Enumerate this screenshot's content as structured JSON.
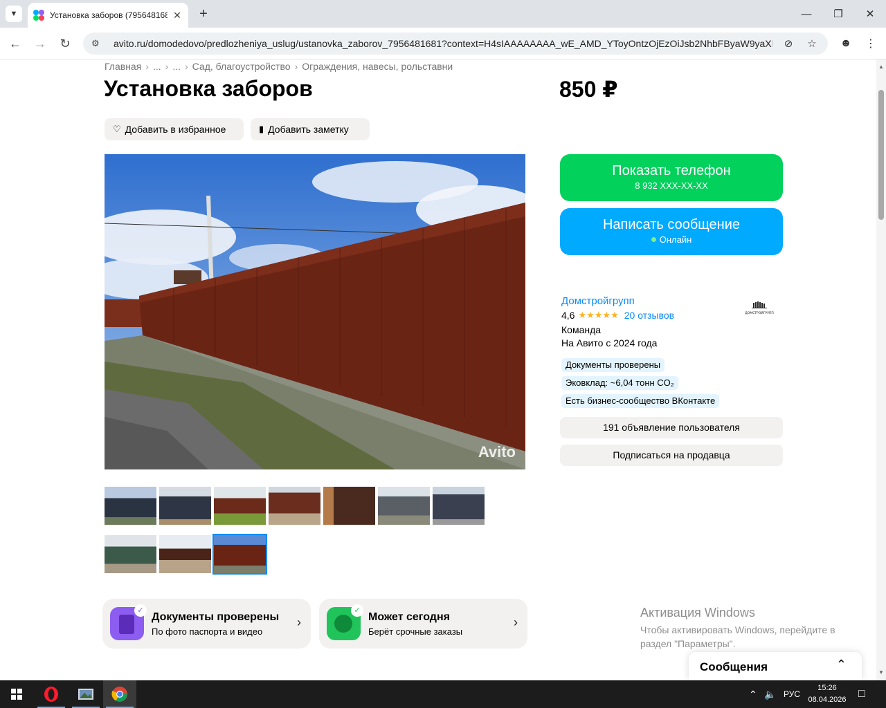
{
  "browser": {
    "tab_title": "Установка заборов (7956481681)",
    "new_tab": "+",
    "url": "avito.ru/domodedovo/predlozheniya_uslug/ustanovka_zaborov_7956481681?context=H4sIAAAAAAAA_wE_AMD_YToyOntzOjEzOiJsb2NhbFByaW9yaXR5Ijt..."
  },
  "breadcrumb": [
    "Главная",
    "...",
    "...",
    "Сад, благоустройство",
    "Ограждения, навесы, рольставни"
  ],
  "listing": {
    "title": "Установка заборов",
    "price": "850 ₽",
    "add_favorite": "Добавить в избранное",
    "add_note": "Добавить заметку",
    "watermark": "Avito"
  },
  "contact": {
    "phone_label": "Показать телефон",
    "phone_masked": "8 932 XXX-XX-XX",
    "message_label": "Написать сообщение",
    "online_status": "Онлайн"
  },
  "seller": {
    "name": "Домстройгрупп",
    "rating": "4,6",
    "stars": "★★★★★",
    "reviews": "20 отзывов",
    "type": "Команда",
    "since": "На Авито с 2024 года",
    "logo_text": "ДОМСТРОЙГРУПП",
    "badges": [
      "Документы проверены",
      "Эковклад: ~6,04 тонн CO₂",
      "Есть бизнес-сообщество ВКонтакте"
    ],
    "listings_button": "191 объявление пользователя",
    "subscribe_button": "Подписаться на продавца"
  },
  "cards": [
    {
      "title": "Документы проверены",
      "subtitle": "По фото паспорта и видео"
    },
    {
      "title": "Может сегодня",
      "subtitle": "Берёт срочные заказы"
    }
  ],
  "activation": {
    "title": "Активация Windows",
    "line1": "Чтобы активировать Windows, перейдите в",
    "line2": "раздел \"Параметры\"."
  },
  "messages_label": "Сообщения",
  "taskbar": {
    "language": "РУС",
    "time": "15:26",
    "date": "08.04.2026"
  },
  "colors": {
    "green": "#02d15c",
    "blue": "#00aaff",
    "link": "#0a8cf3",
    "badge_bg": "#e3f4fe"
  }
}
